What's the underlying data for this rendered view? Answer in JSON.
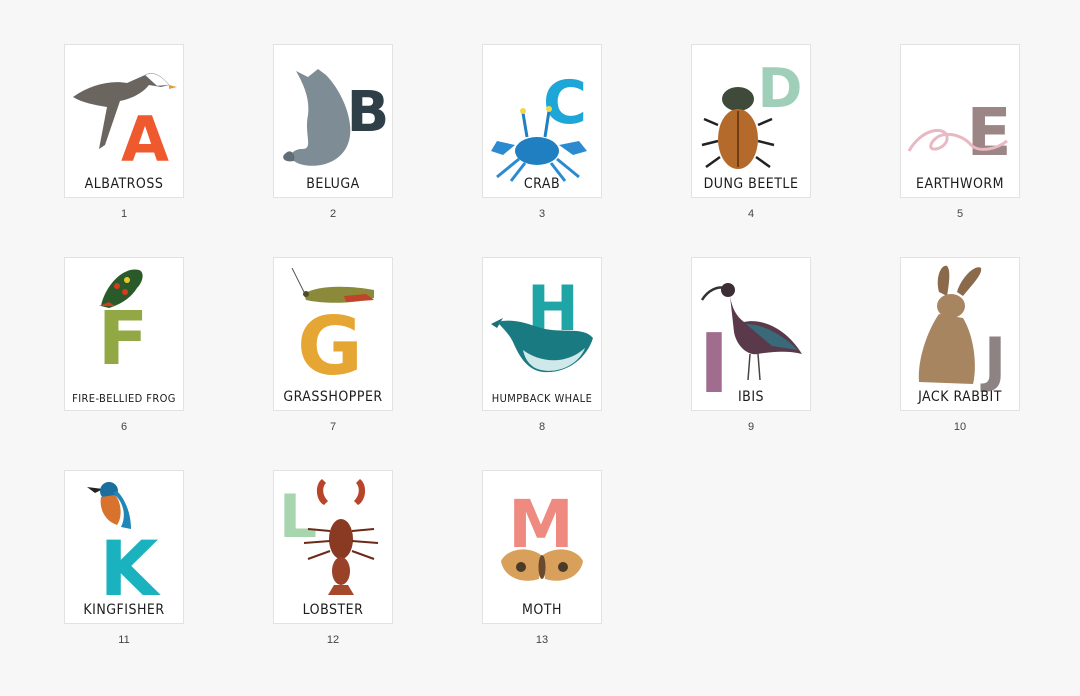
{
  "pages": [
    {
      "number": "1",
      "label": "ALBATROSS",
      "letter": "A",
      "letter_color": "#ee5a2e",
      "animal_icon": "albatross-icon"
    },
    {
      "number": "2",
      "label": "BELUGA",
      "letter": "B",
      "letter_color": "#2f3f48",
      "animal_icon": "beluga-icon"
    },
    {
      "number": "3",
      "label": "CRAB",
      "letter": "C",
      "letter_color": "#1ea6d9",
      "animal_icon": "crab-icon"
    },
    {
      "number": "4",
      "label": "DUNG BEETLE",
      "letter": "D",
      "letter_color": "#9fcfb8",
      "animal_icon": "dung-beetle-icon"
    },
    {
      "number": "5",
      "label": "EARTHWORM",
      "letter": "E",
      "letter_color": "#9b8585",
      "animal_icon": "earthworm-icon"
    },
    {
      "number": "6",
      "label": "FIRE-BELLIED FROG",
      "letter": "F",
      "letter_color": "#92a845",
      "animal_icon": "frog-icon"
    },
    {
      "number": "7",
      "label": "GRASSHOPPER",
      "letter": "G",
      "letter_color": "#e5a633",
      "animal_icon": "grasshopper-icon"
    },
    {
      "number": "8",
      "label": "HUMPBACK WHALE",
      "letter": "H",
      "letter_color": "#1fa5a5",
      "animal_icon": "humpback-whale-icon"
    },
    {
      "number": "9",
      "label": "IBIS",
      "letter": "I",
      "letter_color": "#a06d8e",
      "animal_icon": "ibis-icon"
    },
    {
      "number": "10",
      "label": "JACK RABBIT",
      "letter": "J",
      "letter_color": "#8d8383",
      "animal_icon": "jack-rabbit-icon"
    },
    {
      "number": "11",
      "label": "KINGFISHER",
      "letter": "K",
      "letter_color": "#1ab2bf",
      "animal_icon": "kingfisher-icon"
    },
    {
      "number": "12",
      "label": "LOBSTER",
      "letter": "L",
      "letter_color": "#a7d6ae",
      "animal_icon": "lobster-icon"
    },
    {
      "number": "13",
      "label": "MOTH",
      "letter": "M",
      "letter_color": "#ef8a80",
      "animal_icon": "moth-icon"
    }
  ]
}
